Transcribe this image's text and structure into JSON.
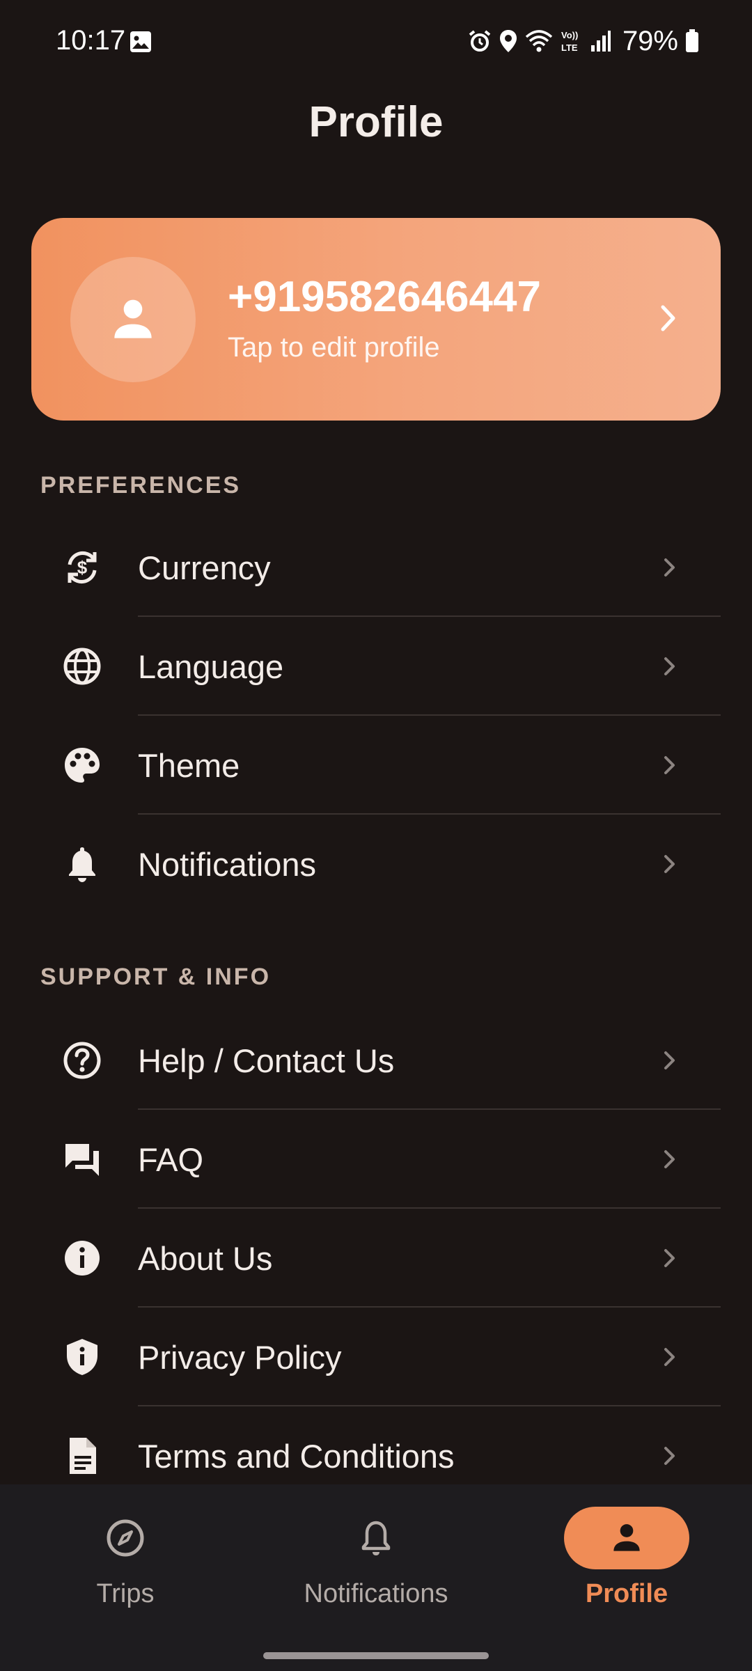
{
  "status_bar": {
    "time": "10:17",
    "battery": "79%"
  },
  "page": {
    "title": "Profile"
  },
  "profile_card": {
    "phone": "+919582646447",
    "subtitle": "Tap to edit profile"
  },
  "sections": {
    "preferences": {
      "header": "PREFERENCES",
      "items": [
        {
          "label": "Currency",
          "icon": "currency-exchange-icon"
        },
        {
          "label": "Language",
          "icon": "globe-icon"
        },
        {
          "label": "Theme",
          "icon": "palette-icon"
        },
        {
          "label": "Notifications",
          "icon": "bell-icon"
        }
      ]
    },
    "support": {
      "header": "SUPPORT & INFO",
      "items": [
        {
          "label": "Help / Contact Us",
          "icon": "help-circle-icon"
        },
        {
          "label": "FAQ",
          "icon": "forum-icon"
        },
        {
          "label": "About Us",
          "icon": "info-icon"
        },
        {
          "label": "Privacy Policy",
          "icon": "shield-icon"
        },
        {
          "label": "Terms and Conditions",
          "icon": "document-icon"
        }
      ]
    }
  },
  "bottom_nav": {
    "tabs": [
      {
        "label": "Trips",
        "icon": "compass-icon"
      },
      {
        "label": "Notifications",
        "icon": "bell-outline-icon"
      },
      {
        "label": "Profile",
        "icon": "person-icon"
      }
    ],
    "active_index": 2
  },
  "colors": {
    "accent": "#f08c56",
    "background": "#1b1514",
    "nav_background": "#1e1c1f"
  }
}
